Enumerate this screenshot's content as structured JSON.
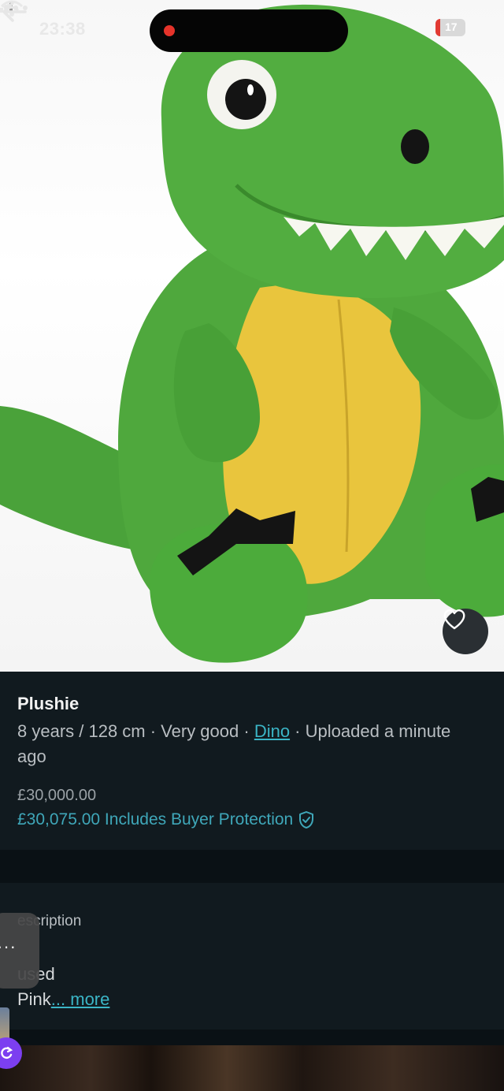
{
  "status_bar": {
    "time": "23:38",
    "battery": "17",
    "battery_level": 0.17,
    "recording_color": "#e5332a"
  },
  "listing": {
    "title": "Plushie",
    "meta_prefix": "8 years / 128 cm · Very good · ",
    "meta_brand": "Dino",
    "meta_suffix": " · Uploaded a minute ago",
    "price": "£30,000.00",
    "price_total": "£30,075.00 Includes Buyer Protection"
  },
  "description": {
    "heading": "Description",
    "heading_visible": "escription",
    "line1": "used",
    "line2": "Pink",
    "more": "... more"
  },
  "float_panel": {
    "dots": "···"
  },
  "icons": {
    "back": "back-arrow-icon",
    "more": "more-icon",
    "favourite": "heart-icon",
    "protection": "shield-check-icon"
  },
  "colors": {
    "background": "#111a1f",
    "accent": "#3bb5c6",
    "plush_green": "#4fa83d",
    "plush_belly": "#e9c53d"
  }
}
